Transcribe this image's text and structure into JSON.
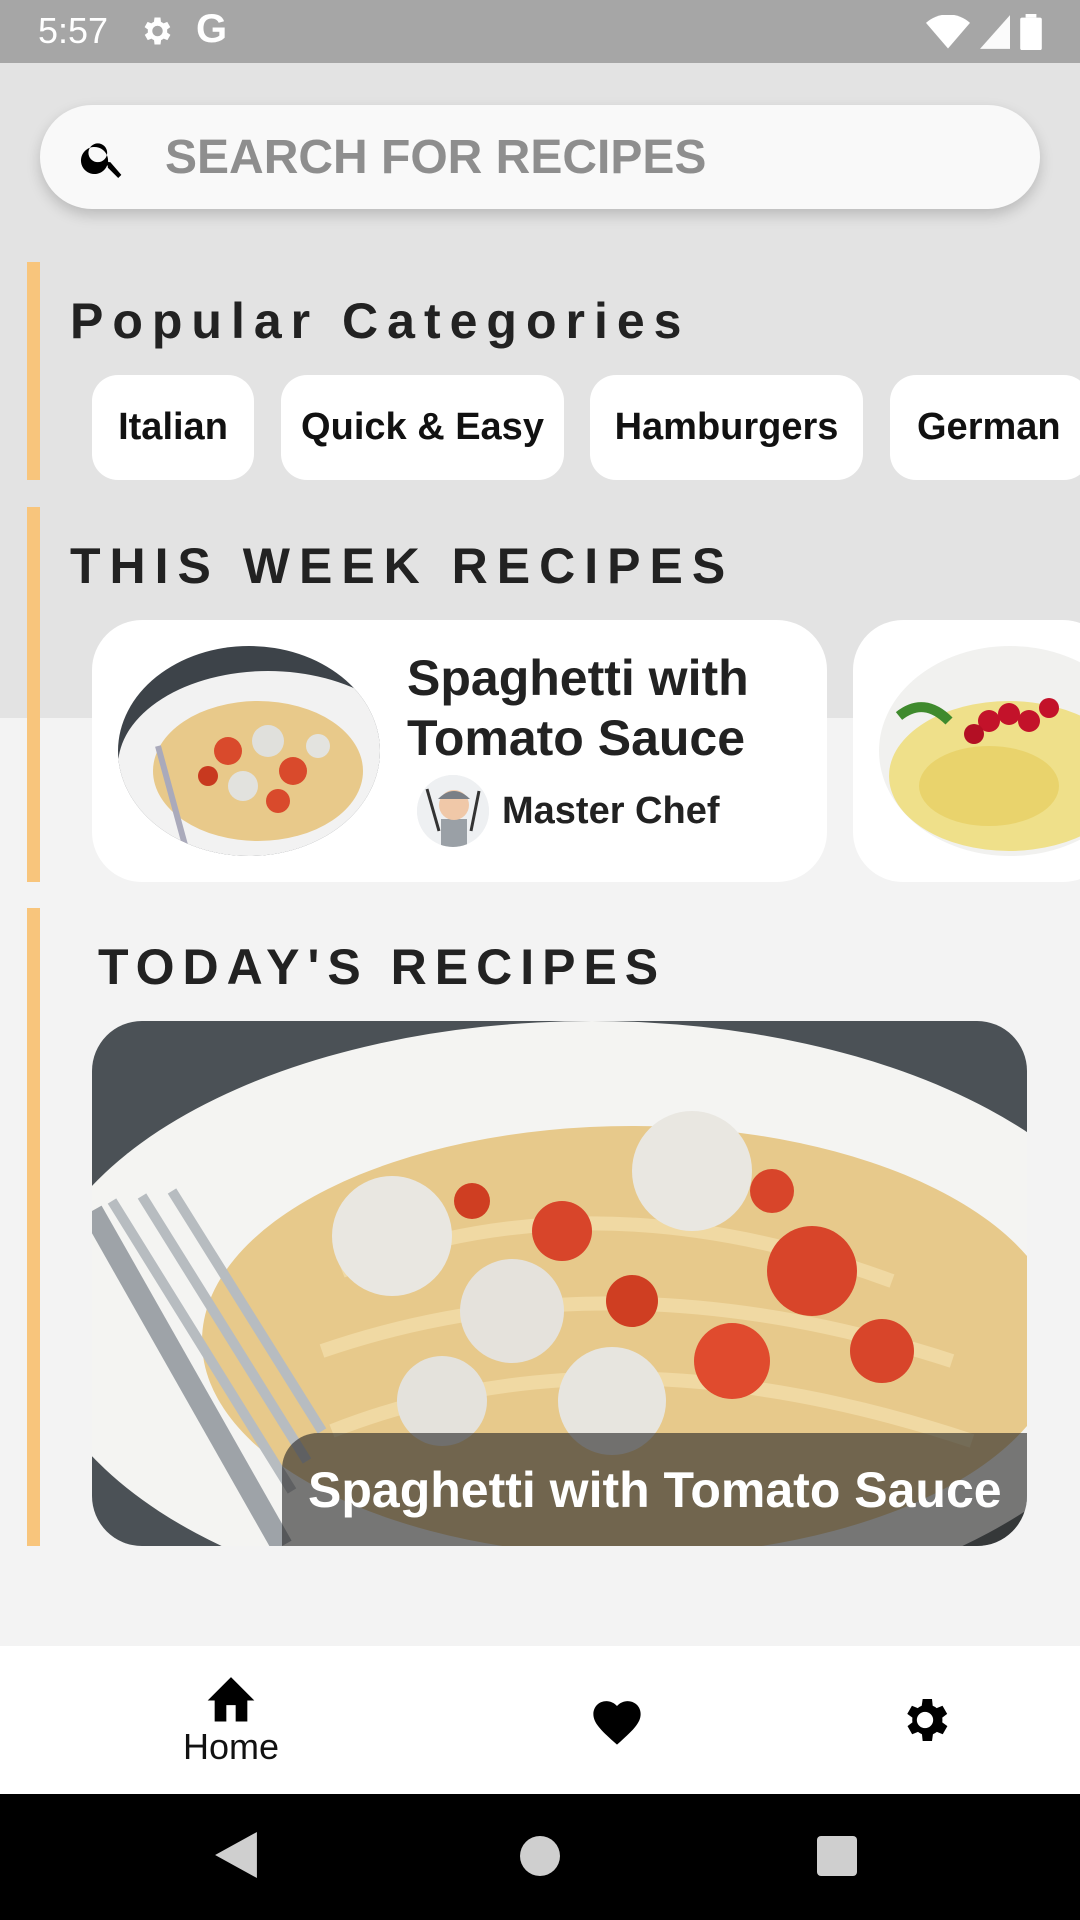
{
  "status_bar": {
    "time": "5:57",
    "g_label": "G"
  },
  "search": {
    "placeholder": "SEARCH FOR RECIPES",
    "value": ""
  },
  "popular": {
    "title": "Popular Categories",
    "chips": [
      "Italian",
      "Quick & Easy",
      "Hamburgers",
      "German"
    ]
  },
  "week": {
    "title": "THIS WEEK RECIPES",
    "cards": [
      {
        "title": "Spaghetti with Tomato Sauce",
        "chef": "Master Chef"
      }
    ]
  },
  "today": {
    "title": "TODAY'S RECIPES",
    "card_title": "Spaghetti with Tomato Sauce"
  },
  "nav": {
    "home_label": "Home",
    "items": [
      "home-icon",
      "heart-icon",
      "settings-icon"
    ]
  },
  "colors": {
    "accent": "#f8c57c",
    "status_bar": "#a6a6a6",
    "top_bg": "#e3e3e3"
  }
}
